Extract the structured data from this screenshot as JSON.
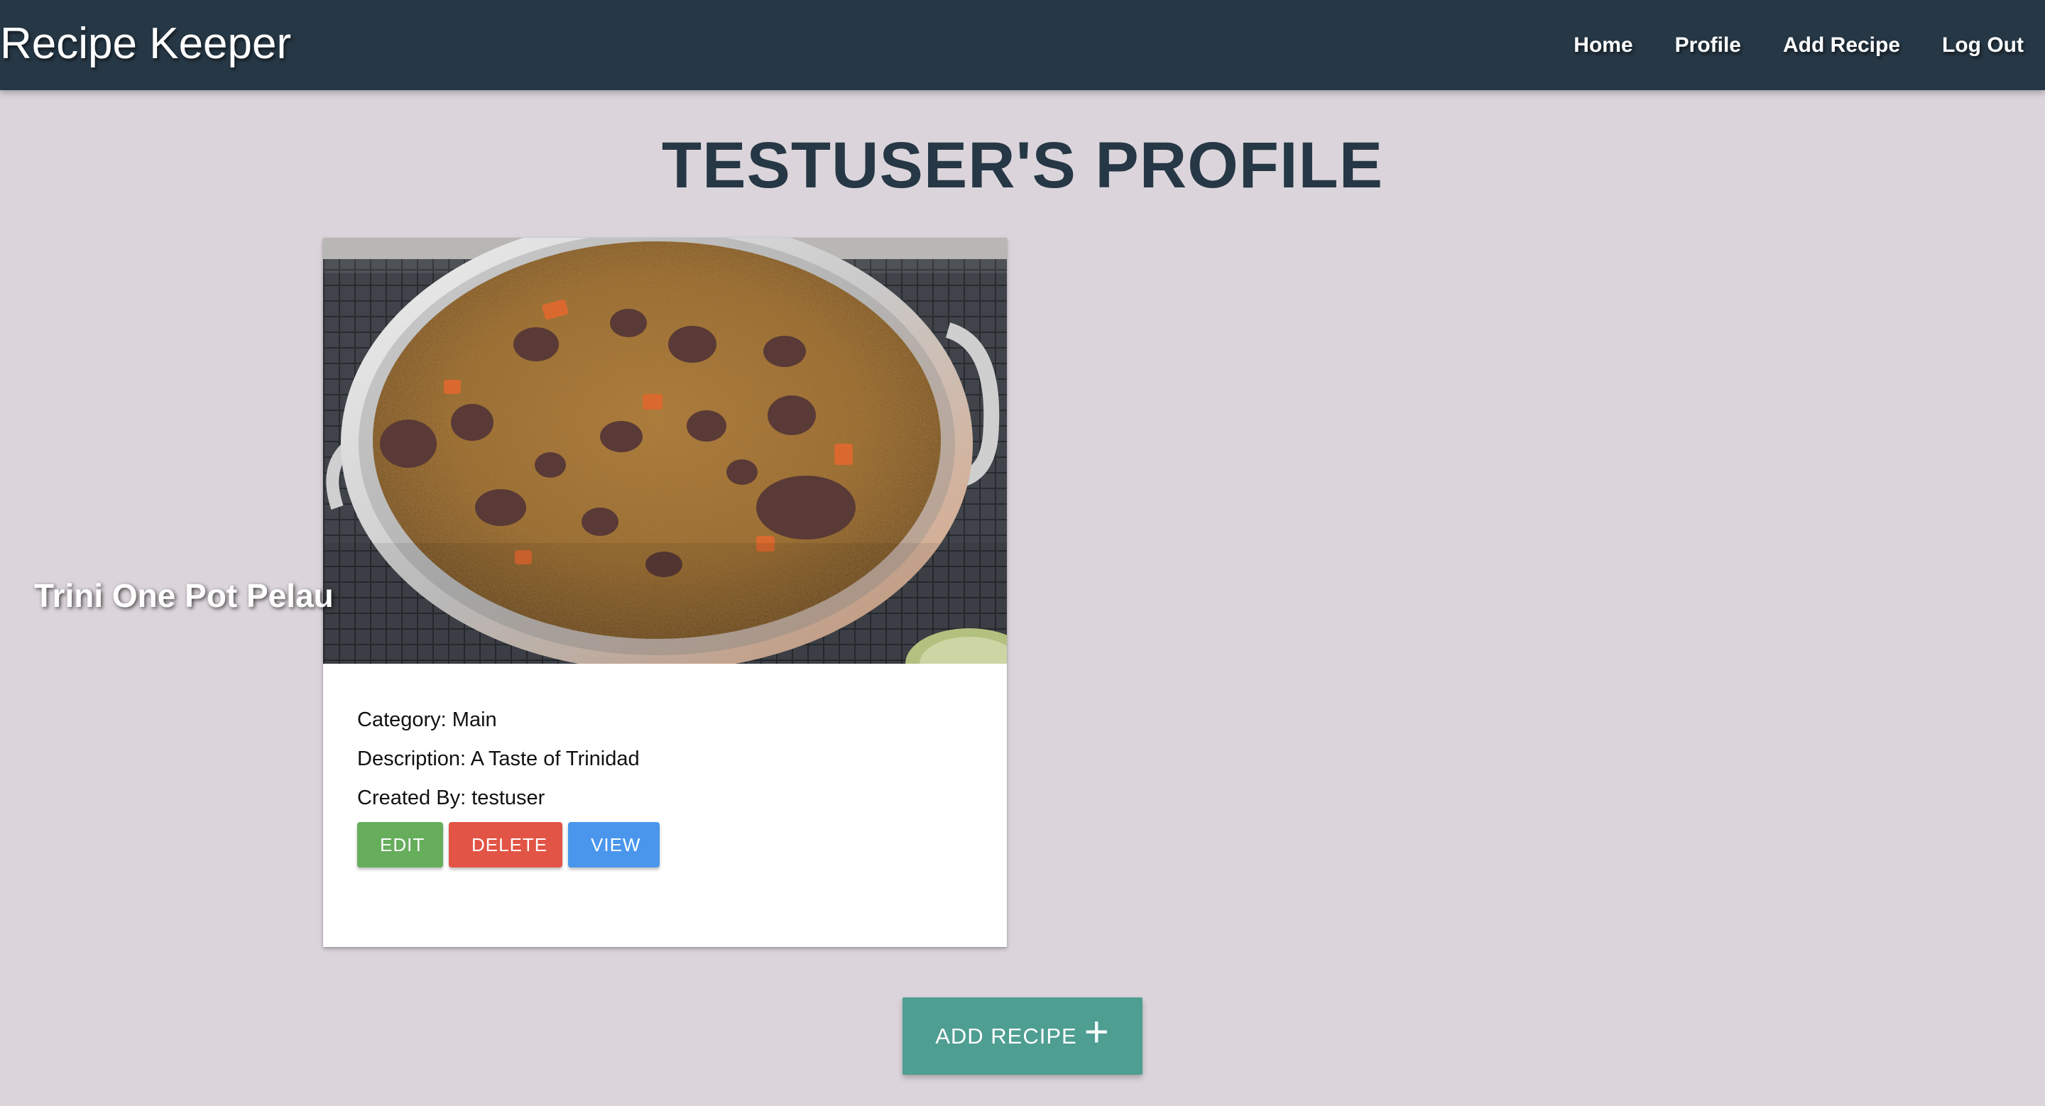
{
  "navbar": {
    "brand": "Recipe Keeper",
    "links": [
      "Home",
      "Profile",
      "Add Recipe",
      "Log Out"
    ]
  },
  "page": {
    "title": "TESTUSER'S PROFILE"
  },
  "recipe_card": {
    "title": "Trini One Pot Pelau",
    "category": "Category: Main",
    "description": "Description: A Taste of Trinidad",
    "created_by": "Created By: testuser",
    "actions": {
      "edit": "EDIT",
      "delete": "DELETE",
      "view": "VIEW"
    }
  },
  "add_recipe_button": {
    "label": "ADD RECIPE",
    "icon": "plus-icon"
  },
  "colors": {
    "navbar": "#263745",
    "background": "#dbd5db",
    "edit": "#66ad5c",
    "delete": "#e25445",
    "view": "#4a96ec",
    "add_recipe": "#4e9e92"
  }
}
